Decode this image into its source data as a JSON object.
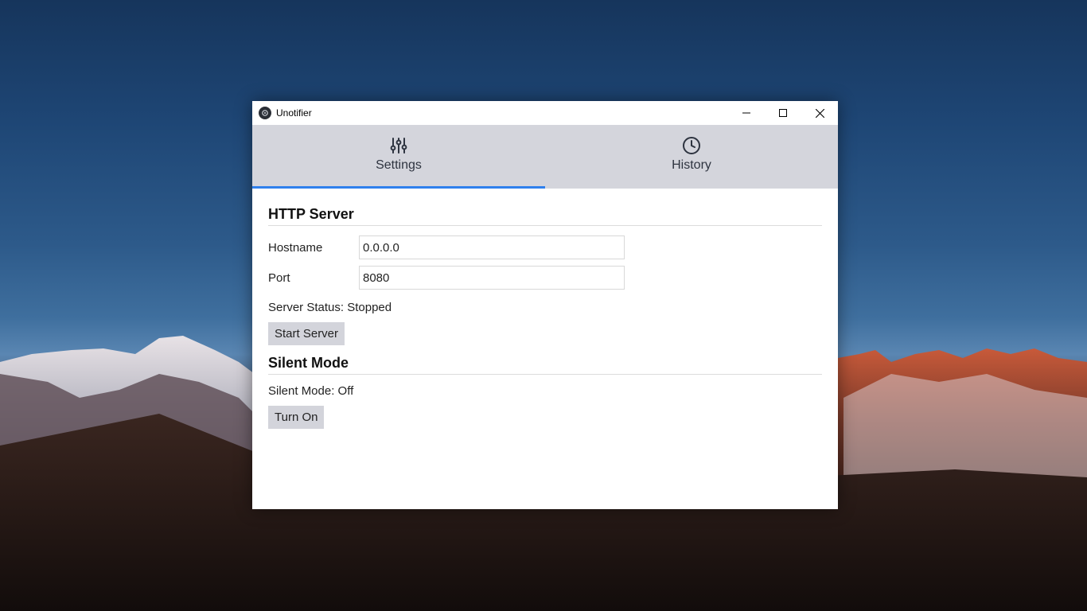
{
  "window": {
    "title": "Unotifier"
  },
  "tabs": [
    {
      "label": "Settings",
      "icon": "sliders-icon",
      "active": true
    },
    {
      "label": "History",
      "icon": "clock-icon",
      "active": false
    }
  ],
  "http_server": {
    "title": "HTTP Server",
    "hostname_label": "Hostname",
    "hostname_value": "0.0.0.0",
    "port_label": "Port",
    "port_value": "8080",
    "status_text": "Server Status: Stopped",
    "start_button": "Start Server"
  },
  "silent_mode": {
    "title": "Silent Mode",
    "status_text": "Silent Mode: Off",
    "toggle_button": "Turn On"
  },
  "colors": {
    "tab_bar": "#d4d5dc",
    "active_indicator": "#2f80ed",
    "button_bg": "#d3d4db"
  }
}
